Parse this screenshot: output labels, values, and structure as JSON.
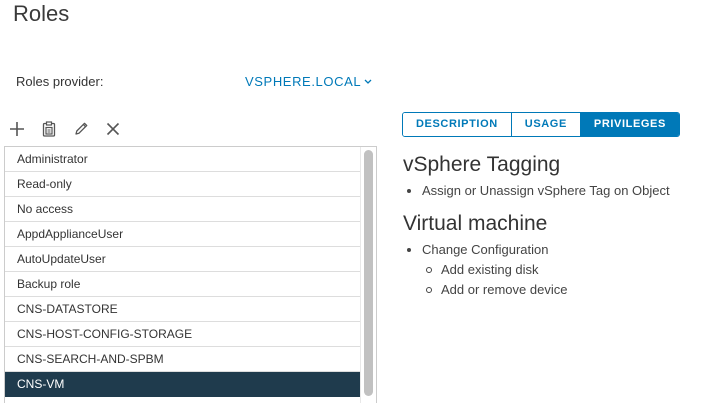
{
  "page": {
    "title": "Roles"
  },
  "provider": {
    "label": "Roles provider:",
    "value": "VSPHERE.LOCAL"
  },
  "toolbar": {
    "icons": [
      "add-icon",
      "clone-icon",
      "edit-icon",
      "delete-icon"
    ]
  },
  "roles": {
    "items": [
      "Administrator",
      "Read-only",
      "No access",
      "AppdApplianceUser",
      "AutoUpdateUser",
      "Backup role",
      "CNS-DATASTORE",
      "CNS-HOST-CONFIG-STORAGE",
      "CNS-SEARCH-AND-SPBM",
      "CNS-VM"
    ],
    "selected": "CNS-VM"
  },
  "tabs": {
    "description": "DESCRIPTION",
    "usage": "USAGE",
    "privileges": "PRIVILEGES",
    "active": "PRIVILEGES"
  },
  "privileges": {
    "tagging": {
      "heading": "vSphere Tagging",
      "items": [
        "Assign or Unassign vSphere Tag on Object"
      ]
    },
    "vm": {
      "heading": "Virtual machine",
      "item": "Change Configuration",
      "subitems": [
        "Add existing disk",
        "Add or remove device"
      ]
    }
  },
  "colors": {
    "accent": "#0079b8",
    "selected_row": "#1f3b4d"
  }
}
